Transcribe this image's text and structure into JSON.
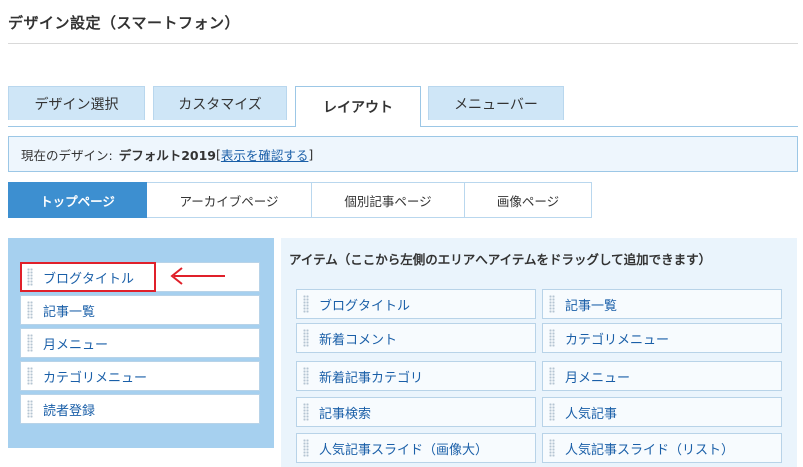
{
  "page": {
    "title": "デザイン設定（スマートフォン）"
  },
  "main_tabs": [
    {
      "label": "デザイン選択"
    },
    {
      "label": "カスタマイズ"
    },
    {
      "label": "レイアウト"
    },
    {
      "label": "メニューバー"
    }
  ],
  "active_main_tab": "レイアウト",
  "current_design": {
    "prefix": "現在のデザイン:",
    "name": "デフォルト2019",
    "bracket_open": "[",
    "link": "表示を確認する",
    "bracket_close": "]"
  },
  "page_tabs": [
    {
      "label": "トップページ"
    },
    {
      "label": "アーカイブページ"
    },
    {
      "label": "個別記事ページ"
    },
    {
      "label": "画像ページ"
    }
  ],
  "active_page_tab": "トップページ",
  "left_items": [
    {
      "label": "ブログタイトル"
    },
    {
      "label": "記事一覧"
    },
    {
      "label": "月メニュー"
    },
    {
      "label": "カテゴリメニュー"
    },
    {
      "label": "読者登録"
    }
  ],
  "items_panel": {
    "title": "アイテム（ここから左側のエリアへアイテムをドラッグして追加できます）",
    "items": [
      {
        "label": "ブログタイトル"
      },
      {
        "label": "記事一覧"
      },
      {
        "label": "新着コメント"
      },
      {
        "label": "カテゴリメニュー"
      },
      {
        "label": "新着記事カテゴリ"
      },
      {
        "label": "月メニュー"
      },
      {
        "label": "記事検索"
      },
      {
        "label": "人気記事"
      },
      {
        "label": "人気記事スライド（画像大）"
      },
      {
        "label": "人気記事スライド（リスト）"
      }
    ]
  },
  "colors": {
    "tab_bg": "#cfe6f7",
    "active_page_tab": "#3d8fd0",
    "left_area_bg": "#a6d0ef",
    "right_area_bg": "#eaf4fc",
    "highlight": "#e0202a",
    "link": "#1a5fa8"
  },
  "annotation": {
    "arrow_icon": "left-arrow-icon"
  }
}
